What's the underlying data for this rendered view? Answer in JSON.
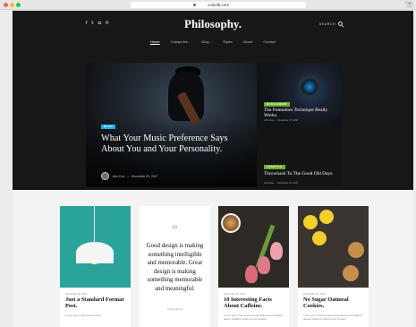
{
  "browser": {
    "url": "colorlib.com"
  },
  "header": {
    "social_icons": [
      "facebook-icon",
      "twitter-icon",
      "instagram-icon",
      "pinterest-icon"
    ],
    "social_glyphs": [
      "f",
      "𝕥",
      "◘",
      "℗"
    ],
    "logo": "Philosophy.",
    "search_label": "SEARCH"
  },
  "nav": {
    "items": [
      {
        "label": "Home",
        "active": true
      },
      {
        "label": "Categories",
        "has_dropdown": true
      },
      {
        "label": "Blog",
        "has_dropdown": true
      },
      {
        "label": "Styles"
      },
      {
        "label": "About"
      },
      {
        "label": "Contact"
      }
    ]
  },
  "featured": {
    "main": {
      "category": "MUSIC",
      "category_color": "#1ab1e8",
      "title": "What Your Music Preference Says About You and Your Personality.",
      "author": "John Doe",
      "date": "December 29, 2017"
    },
    "side": [
      {
        "category": "MANAGEMENT",
        "category_color": "#6fae2e",
        "title": "The Pomodoro Technique Really Works.",
        "author": "John Doe",
        "date": "December 27, 2017"
      },
      {
        "category": "LIFESTYLE",
        "category_color": "#6fae2e",
        "title": "Throwback To The Good Old Days.",
        "author": "John Doe",
        "date": "December 21, 2017"
      }
    ]
  },
  "posts": [
    {
      "date": "December 15, 2017",
      "title": "Just a Standard Format Post.",
      "excerpt": "Lorem ipsum Sed eiusmod esse"
    },
    {
      "quote": "Good design is making something intelligible and memorable. Great design is making something memorable and meaningful.",
      "author": "Dieter Rams"
    },
    {
      "date": "December 15, 2017",
      "title": "10 Interesting Facts About Caffeine.",
      "excerpt": "Lorem ipsum Sed eiusmod esse aliqua sed incididunt aliqua incididunt mollit id et sit proident"
    },
    {
      "date": "December 10, 2017",
      "title": "No Sugar Oatmeal Cookies.",
      "excerpt": "Lorem ipsum Sed eiusmod esse aliqua sed incididunt aliqua incididunt mollit id et sit proident"
    }
  ]
}
